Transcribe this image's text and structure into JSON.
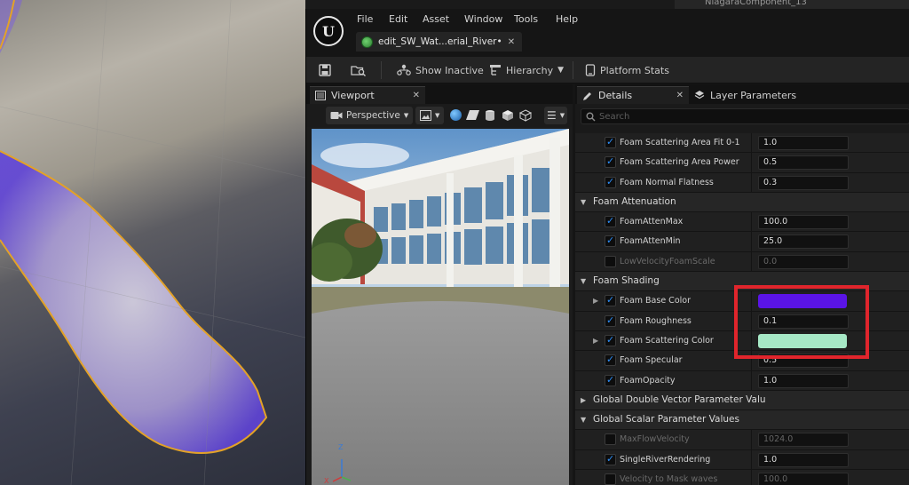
{
  "background": {
    "top_right_item": "NiagaraComponent_13"
  },
  "menu": {
    "items": [
      "File",
      "Edit",
      "Asset",
      "Window",
      "Tools",
      "Help"
    ]
  },
  "document_tab": {
    "label": "edit_SW_Wat...erial_River•",
    "close": "✕"
  },
  "toolbar": {
    "show_inactive": "Show Inactive",
    "hierarchy": "Hierarchy",
    "platform_stats": "Platform Stats"
  },
  "viewport": {
    "tab_label": "Viewport",
    "tab_close": "✕",
    "perspective_label": "Perspective",
    "axis_z": "Z",
    "axis_x": "X"
  },
  "details": {
    "tab_label": "Details",
    "tab_close": "✕",
    "layer_tab_label": "Layer Parameters",
    "search_placeholder": "Search"
  },
  "rows": [
    {
      "type": "prop",
      "name": "Foam Scattering Area Fit 0-1",
      "checked": true,
      "value": "1.0"
    },
    {
      "type": "prop",
      "name": "Foam Scattering Area Power",
      "checked": true,
      "value": "0.5"
    },
    {
      "type": "prop",
      "name": "Foam Normal Flatness",
      "checked": true,
      "value": "0.3"
    },
    {
      "type": "cat",
      "name": "Foam Attenuation",
      "expanded": true
    },
    {
      "type": "prop",
      "name": "FoamAttenMax",
      "checked": true,
      "value": "100.0"
    },
    {
      "type": "prop",
      "name": "FoamAttenMin",
      "checked": true,
      "value": "25.0"
    },
    {
      "type": "prop",
      "name": "LowVelocityFoamScale",
      "checked": false,
      "value": "0.0",
      "dim": true
    },
    {
      "type": "cat",
      "name": "Foam Shading",
      "expanded": true
    },
    {
      "type": "prop",
      "name": "Foam Base Color",
      "checked": true,
      "expander": true,
      "color": "#5a14e6"
    },
    {
      "type": "prop",
      "name": "Foam Roughness",
      "checked": true,
      "value": "0.1"
    },
    {
      "type": "prop",
      "name": "Foam Scattering Color",
      "checked": true,
      "expander": true,
      "color": "#a6e8c6"
    },
    {
      "type": "prop",
      "name": "Foam Specular",
      "checked": true,
      "value": "0.5"
    },
    {
      "type": "prop",
      "name": "FoamOpacity",
      "checked": true,
      "value": "1.0"
    },
    {
      "type": "cat",
      "name": "Global Double Vector Parameter Valu",
      "expanded": false
    },
    {
      "type": "cat",
      "name": "Global Scalar Parameter Values",
      "expanded": true
    },
    {
      "type": "prop",
      "name": "MaxFlowVelocity",
      "checked": false,
      "value": "1024.0",
      "dim": true
    },
    {
      "type": "prop",
      "name": "SingleRiverRendering",
      "checked": true,
      "value": "1.0"
    },
    {
      "type": "prop",
      "name": "Velocity to Mask waves",
      "checked": false,
      "value": "100.0",
      "dim": true
    }
  ],
  "colors": {
    "highlight": "#e0252c",
    "checkbox_accent": "#2c8ef8"
  }
}
